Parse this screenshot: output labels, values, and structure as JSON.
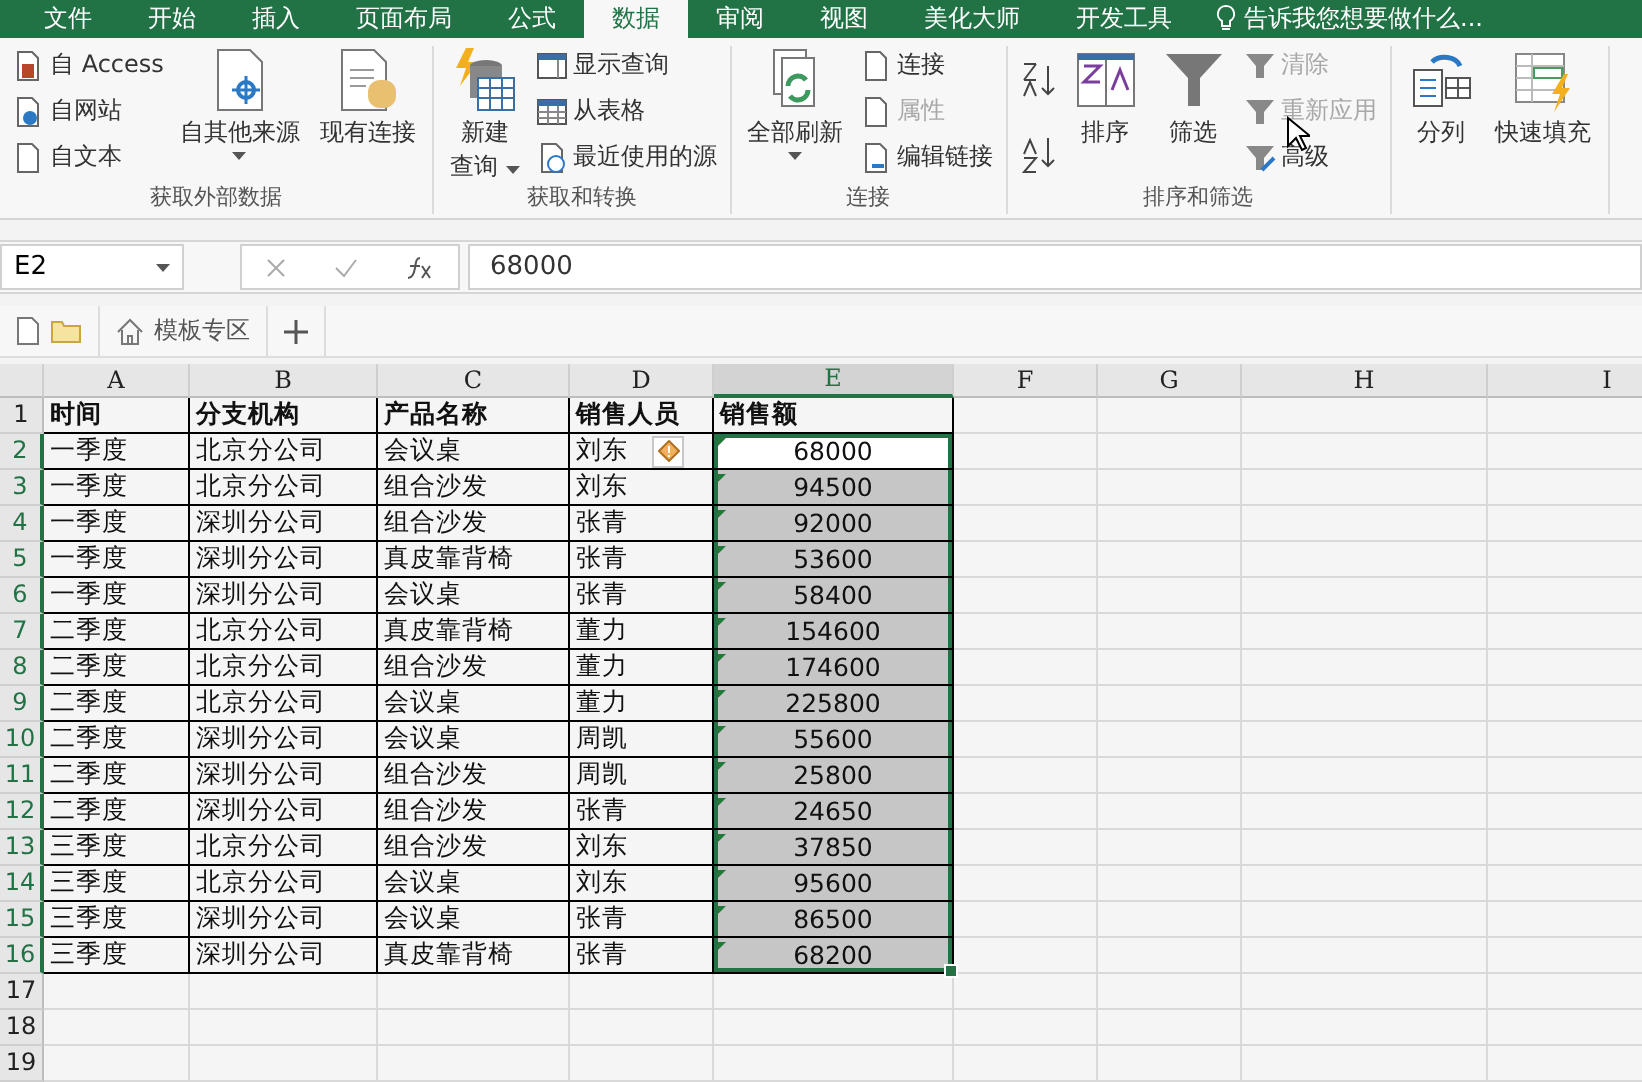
{
  "tabs": [
    {
      "label": "文件",
      "selected": false
    },
    {
      "label": "开始",
      "selected": false
    },
    {
      "label": "插入",
      "selected": false
    },
    {
      "label": "页面布局",
      "selected": false
    },
    {
      "label": "公式",
      "selected": false
    },
    {
      "label": "数据",
      "selected": true
    },
    {
      "label": "审阅",
      "selected": false
    },
    {
      "label": "视图",
      "selected": false
    },
    {
      "label": "美化大师",
      "selected": false
    },
    {
      "label": "开发工具",
      "selected": false
    }
  ],
  "tell_me": "告诉我您想要做什么...",
  "ribbon": {
    "groups": [
      {
        "label": "获取外部数据",
        "items": [
          {
            "kind": "stack",
            "buttons": [
              {
                "label": "自 Access",
                "disabled": false
              },
              {
                "label": "自网站",
                "disabled": false
              },
              {
                "label": "自文本",
                "disabled": false
              }
            ]
          },
          {
            "kind": "large",
            "label": "自其他来源",
            "dropdown": true
          },
          {
            "kind": "large",
            "label": "现有连接",
            "dropdown": false
          }
        ]
      },
      {
        "label": "获取和转换",
        "items": [
          {
            "kind": "large",
            "label": "新建",
            "label2": "查询",
            "dropdown": true
          },
          {
            "kind": "stack",
            "buttons": [
              {
                "label": "显示查询",
                "disabled": false
              },
              {
                "label": "从表格",
                "disabled": false
              },
              {
                "label": "最近使用的源",
                "disabled": false
              }
            ]
          }
        ]
      },
      {
        "label": "连接",
        "items": [
          {
            "kind": "large",
            "label": "全部刷新",
            "dropdown": true
          },
          {
            "kind": "stack",
            "buttons": [
              {
                "label": "连接",
                "disabled": false
              },
              {
                "label": "属性",
                "disabled": true
              },
              {
                "label": "编辑链接",
                "disabled": false
              }
            ]
          }
        ]
      },
      {
        "label": "排序和筛选",
        "items": [
          {
            "kind": "sorters"
          },
          {
            "kind": "large",
            "label": "排序",
            "dropdown": false
          },
          {
            "kind": "large",
            "label": "筛选",
            "dropdown": false
          },
          {
            "kind": "stack",
            "buttons": [
              {
                "label": "清除",
                "disabled": true
              },
              {
                "label": "重新应用",
                "disabled": true
              },
              {
                "label": "高级",
                "disabled": false
              }
            ]
          }
        ]
      },
      {
        "items": [
          {
            "kind": "large",
            "label": "分列",
            "dropdown": false
          },
          {
            "kind": "large",
            "label": "快速填充",
            "dropdown": false
          }
        ]
      }
    ]
  },
  "formula_bar": {
    "name_box": "E2",
    "value": "68000"
  },
  "quick_tabs": {
    "template_label": "模板专区"
  },
  "sheet": {
    "columns": [
      {
        "label": "A",
        "selected": false
      },
      {
        "label": "B",
        "selected": false
      },
      {
        "label": "C",
        "selected": false
      },
      {
        "label": "D",
        "selected": false
      },
      {
        "label": "E",
        "selected": true
      },
      {
        "label": "F",
        "selected": false
      },
      {
        "label": "G",
        "selected": false
      },
      {
        "label": "H",
        "selected": false
      },
      {
        "label": "I",
        "selected": false
      }
    ],
    "rows": [
      {
        "number": "1",
        "selected": false,
        "header": true,
        "cells": [
          "时间",
          "分支机构",
          "产品名称",
          "销售人员",
          "销售额"
        ]
      },
      {
        "number": "2",
        "selected": true,
        "active": true,
        "warning": true,
        "cells": [
          "一季度",
          "北京分公司",
          "会议桌",
          "刘东",
          "68000"
        ]
      },
      {
        "number": "3",
        "selected": true,
        "cells": [
          "一季度",
          "北京分公司",
          "组合沙发",
          "刘东",
          "94500"
        ]
      },
      {
        "number": "4",
        "selected": true,
        "cells": [
          "一季度",
          "深圳分公司",
          "组合沙发",
          "张青",
          "92000"
        ]
      },
      {
        "number": "5",
        "selected": true,
        "cells": [
          "一季度",
          "深圳分公司",
          "真皮靠背椅",
          "张青",
          "53600"
        ]
      },
      {
        "number": "6",
        "selected": true,
        "cells": [
          "一季度",
          "深圳分公司",
          "会议桌",
          "张青",
          "58400"
        ]
      },
      {
        "number": "7",
        "selected": true,
        "cells": [
          "二季度",
          "北京分公司",
          "真皮靠背椅",
          "董力",
          "154600"
        ]
      },
      {
        "number": "8",
        "selected": true,
        "cells": [
          "二季度",
          "北京分公司",
          "组合沙发",
          "董力",
          "174600"
        ]
      },
      {
        "number": "9",
        "selected": true,
        "cells": [
          "二季度",
          "北京分公司",
          "会议桌",
          "董力",
          "225800"
        ]
      },
      {
        "number": "10",
        "selected": true,
        "cells": [
          "二季度",
          "深圳分公司",
          "会议桌",
          "周凯",
          "55600"
        ]
      },
      {
        "number": "11",
        "selected": true,
        "cells": [
          "二季度",
          "深圳分公司",
          "组合沙发",
          "周凯",
          "25800"
        ]
      },
      {
        "number": "12",
        "selected": true,
        "cells": [
          "二季度",
          "深圳分公司",
          "组合沙发",
          "张青",
          "24650"
        ]
      },
      {
        "number": "13",
        "selected": true,
        "cells": [
          "三季度",
          "北京分公司",
          "组合沙发",
          "刘东",
          "37850"
        ]
      },
      {
        "number": "14",
        "selected": true,
        "cells": [
          "三季度",
          "北京分公司",
          "会议桌",
          "刘东",
          "95600"
        ]
      },
      {
        "number": "15",
        "selected": true,
        "cells": [
          "三季度",
          "深圳分公司",
          "会议桌",
          "张青",
          "86500"
        ]
      },
      {
        "number": "16",
        "selected": true,
        "cells": [
          "三季度",
          "深圳分公司",
          "真皮靠背椅",
          "张青",
          "68200"
        ]
      },
      {
        "number": "17",
        "selected": false
      },
      {
        "number": "18",
        "selected": false
      },
      {
        "number": "19",
        "selected": false
      }
    ]
  }
}
